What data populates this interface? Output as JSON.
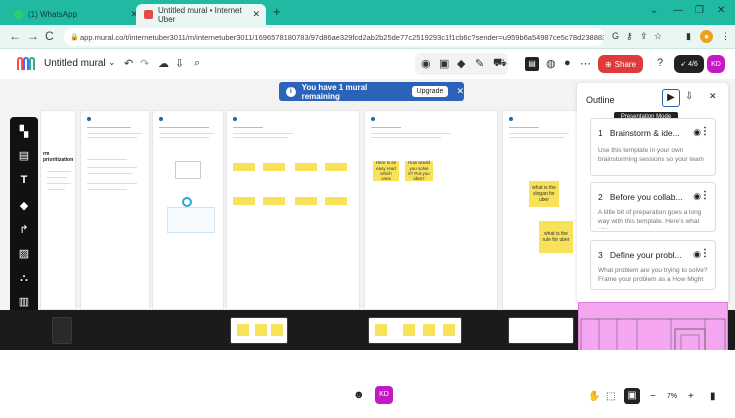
{
  "browser": {
    "tabs": [
      {
        "title": "(1) WhatsApp",
        "active": false
      },
      {
        "title": "Untitled mural • Internet Uber",
        "active": true
      }
    ],
    "new_tab": "+",
    "url": "app.mural.co/t/internetuber3011/m/internetuber3011/1696578180783/97d86ae329fcd2ab2b25de77c2519293c1f1cb6c?sender=u959b6a54987ce5c78d238883"
  },
  "toolbar": {
    "mural_title": "Untitled mural",
    "share_label": "Share",
    "timer_badge": "4/6",
    "avatar_initials": "KD"
  },
  "banner": {
    "text": "You have 1 mural remaining",
    "upgrade_label": "Upgrade"
  },
  "outline": {
    "title": "Outline",
    "tooltip": "Presentation Mode",
    "items": [
      {
        "number": "1",
        "title": "Brainstorm & ide...",
        "description": "Use this template in your own brainstorming sessions so your team"
      },
      {
        "number": "2",
        "title": "Before you collab...",
        "description": "A little bit of preparation goes a long way with this template. Here's what you"
      },
      {
        "number": "3",
        "title": "Define your probl...",
        "description": "What problem are you trying to solve? Frame your problem as a How Might"
      }
    ]
  },
  "canvas": {
    "left_frame_heading": "rm prioritization",
    "stickies": [
      {
        "text": "Here is an easy read which ones"
      },
      {
        "text": "How would you solve it? Put you idea?"
      },
      {
        "text": "what is the slogan for uber"
      },
      {
        "text": "what is the rule for uber"
      }
    ]
  },
  "bottom": {
    "reaction_icon": "smiley-icon",
    "avatar_initials": "KD",
    "zoom_level": "7%"
  },
  "colors": {
    "tab_bar": "#20b9a2",
    "banner": "#2a63b8",
    "share": "#e03b3b",
    "avatar": "#c41ac4",
    "minimap": "#f4a7f0",
    "sticky": "#f7e25a"
  }
}
